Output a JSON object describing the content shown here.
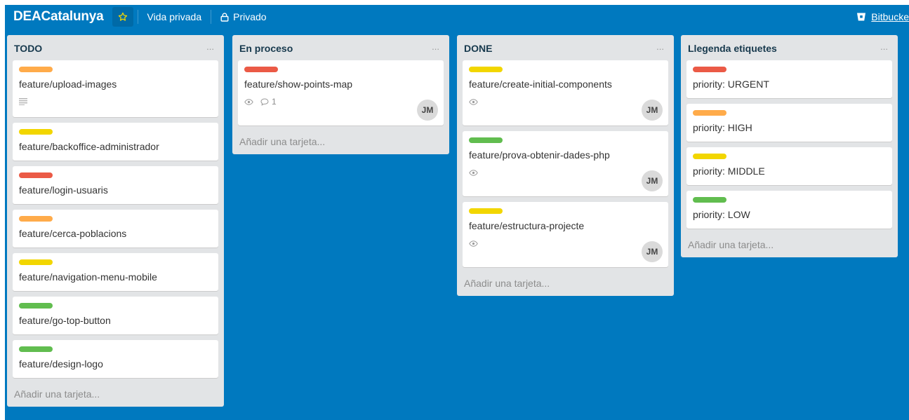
{
  "header": {
    "board_name": "DEACatalunya",
    "visibility_team": "Vida privada",
    "visibility": "Privado",
    "bitbucket_label": "Bitbucke"
  },
  "colors": {
    "board_bg": "#0079bf",
    "label_orange": "#ffab4a",
    "label_yellow": "#f2d600",
    "label_red": "#eb5a46",
    "label_green": "#61bd4f"
  },
  "lists": [
    {
      "title": "TODO",
      "menu": "...",
      "add_card": "Añadir una tarjeta...",
      "cards": [
        {
          "label": "orange",
          "title": "feature/upload-images"
        },
        {
          "label": "yellow",
          "title": "feature/backoffice-administrador"
        },
        {
          "label": "red",
          "title": "feature/login-usuaris"
        },
        {
          "label": "orange",
          "title": "feature/cerca-poblacions"
        },
        {
          "label": "yellow",
          "title": "feature/navigation-menu-mobile"
        },
        {
          "label": "green",
          "title": "feature/go-top-button"
        },
        {
          "label": "green",
          "title": "feature/design-logo"
        }
      ]
    },
    {
      "title": "En proceso",
      "menu": "...",
      "add_card": "Añadir una tarjeta...",
      "cards": [
        {
          "label": "red",
          "title": "feature/show-points-map",
          "comments": "1",
          "member": "JM"
        }
      ]
    },
    {
      "title": "DONE",
      "menu": "...",
      "add_card": "Añadir una tarjeta...",
      "cards": [
        {
          "label": "yellow",
          "title": "feature/create-initial-components",
          "member": "JM"
        },
        {
          "label": "green",
          "title": "feature/prova-obtenir-dades-php",
          "member": "JM"
        },
        {
          "label": "yellow",
          "title": "feature/estructura-projecte",
          "member": "JM"
        }
      ]
    },
    {
      "title": "Llegenda etiquetes",
      "menu": "...",
      "add_card": "Añadir una tarjeta...",
      "cards": [
        {
          "label": "red",
          "title": "priority: URGENT"
        },
        {
          "label": "orange",
          "title": "priority: HIGH"
        },
        {
          "label": "yellow",
          "title": "priority: MIDDLE"
        },
        {
          "label": "green",
          "title": "priority: LOW"
        }
      ]
    }
  ]
}
